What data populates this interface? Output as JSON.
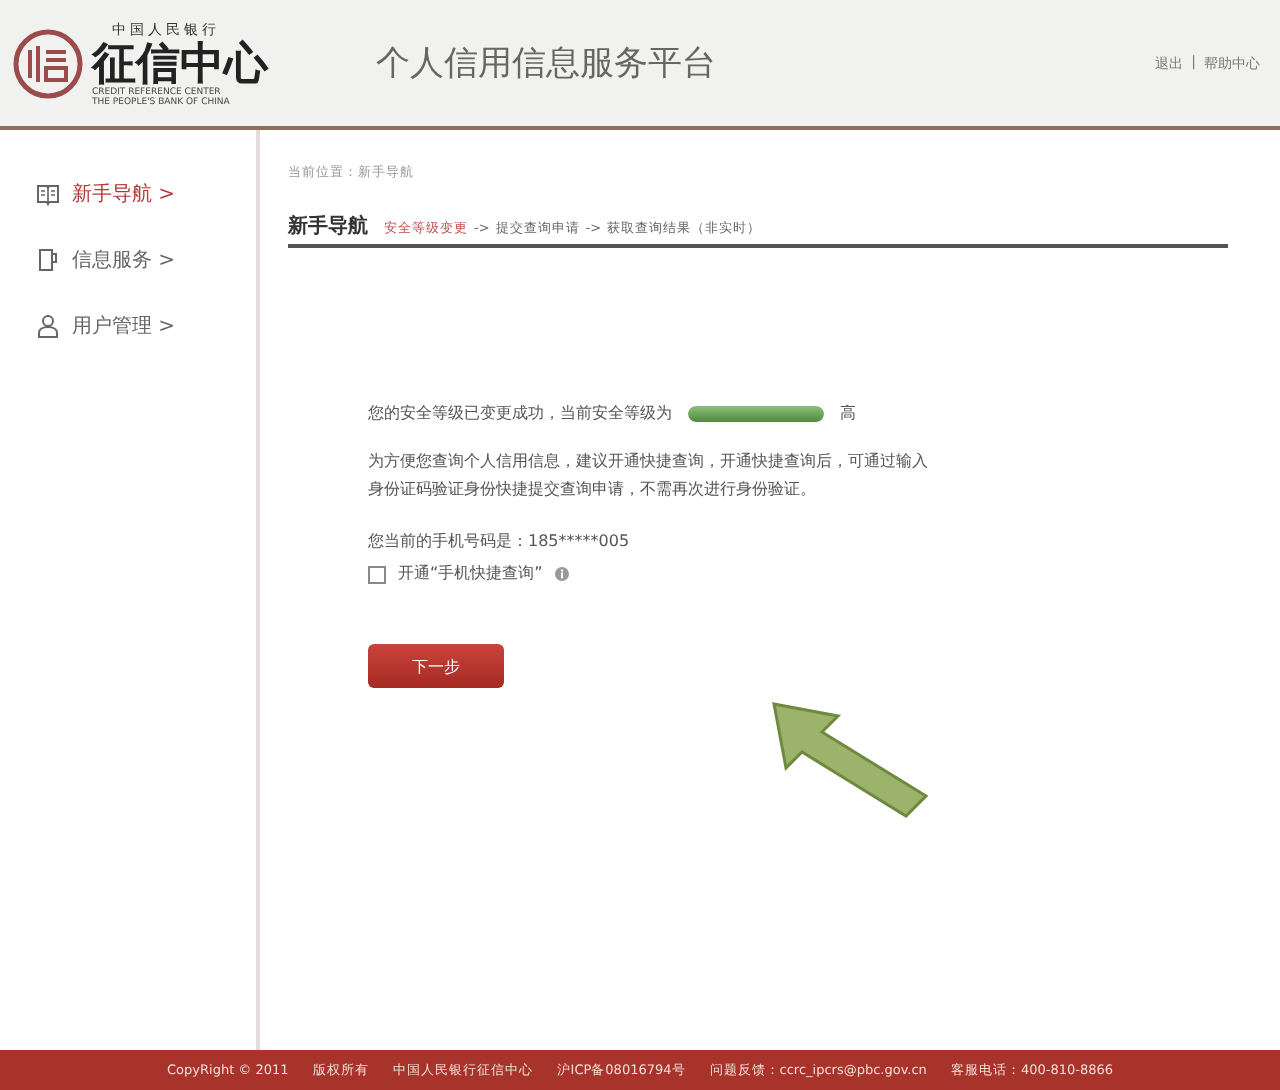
{
  "header": {
    "logo": {
      "top_line": "中国人民银行",
      "name": "征信中心",
      "english_lines": [
        "CREDIT REFERENCE CENTER",
        "THE PEOPLE'S BANK OF CHINA"
      ]
    },
    "title": "个人信用信息服务平台",
    "links": [
      {
        "label": "退出"
      },
      {
        "label": "帮助中心"
      }
    ],
    "link_separator": "|"
  },
  "sidebar": {
    "items": [
      {
        "label": "新手导航 >",
        "selected": true
      },
      {
        "label": "信息服务 >",
        "selected": false
      },
      {
        "label": "用户管理 >",
        "selected": false
      }
    ]
  },
  "breadcrumb": "当前位置：新手导航",
  "section": {
    "title": "新手导航",
    "steps": [
      {
        "label": "安全等级变更",
        "selected": true
      },
      {
        "prefix": "->",
        "label": "提交查询申请",
        "selected": false
      },
      {
        "prefix": "->",
        "label": "获取查询结果（非实时）",
        "selected": false
      }
    ]
  },
  "message": {
    "security_text": "您的安全等级已变更成功，当前安全等级为",
    "security_meter": {
      "level": 1
    },
    "security_level": "高",
    "advice": "为方便您查询个人信用信息，建议开通快捷查询，开通快捷查询后，可通过输入身份证码验证身份快捷提交查询申请，不需再次进行身份验证。",
    "phone": "您当前的手机号码是：185*****005",
    "option": {
      "label": "开通“手机快捷查询”",
      "checked": false
    }
  },
  "buttons": [
    {
      "label": "下一步"
    }
  ],
  "annotation": {
    "kind": "arrow"
  },
  "footer": {
    "items": [
      "CopyRight © 2011",
      "版权所有",
      "中国人民银行征信中心",
      "沪ICP备08016794号",
      "问题反馈：ccrc_ipcrs@pbc.gov.cn",
      "客服电话：400-810-8866"
    ]
  }
}
